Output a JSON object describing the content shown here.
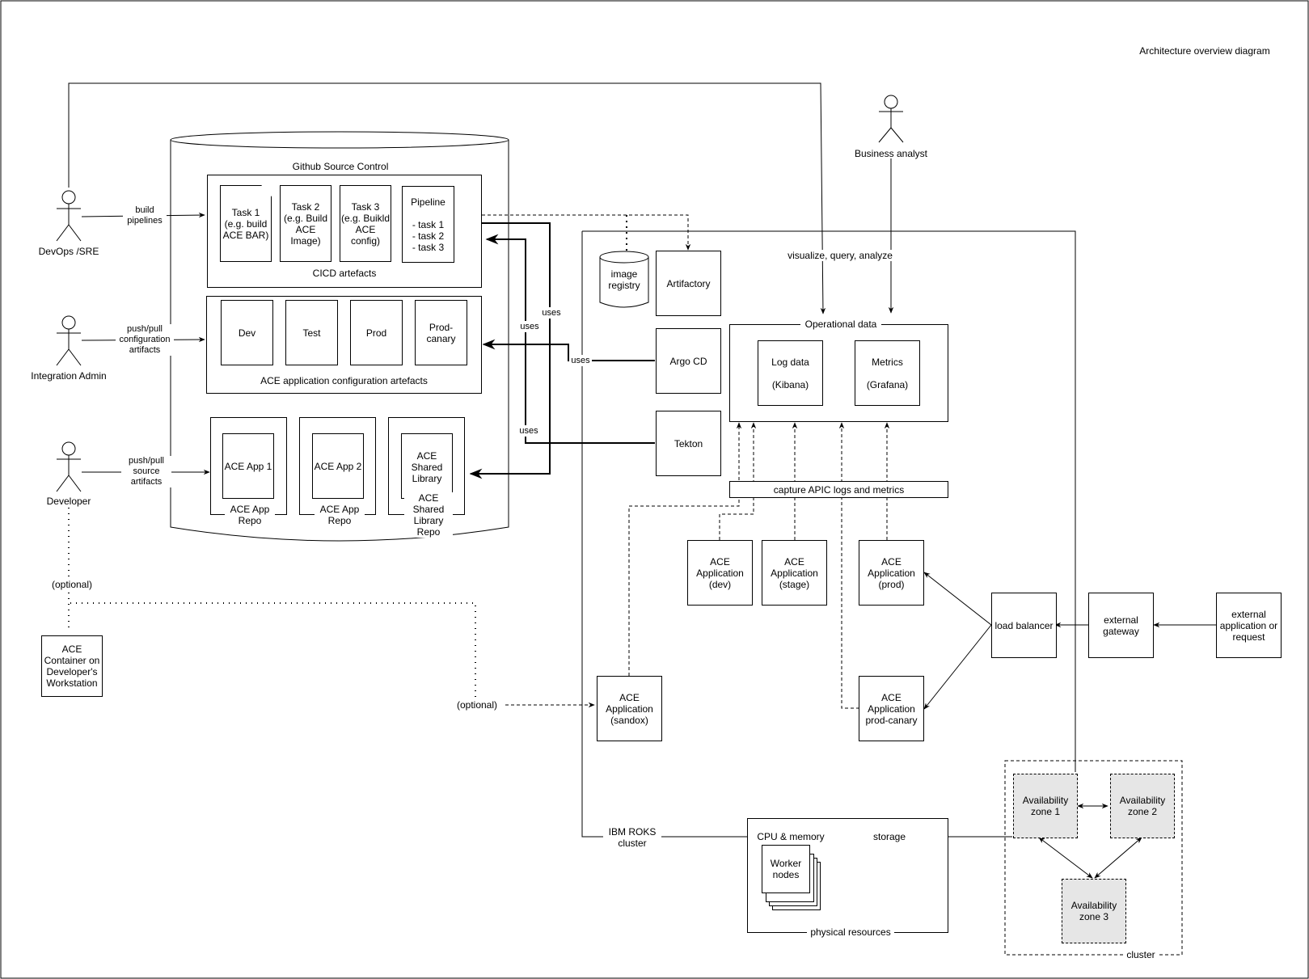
{
  "title": "Architecture overview diagram",
  "actors": {
    "devops": "DevOps /SRE",
    "integration_admin": "Integration Admin",
    "developer": "Developer",
    "business_analyst": "Business analyst"
  },
  "edge_labels": {
    "build_pipelines": "build\npipelines",
    "push_pull_config": "push/pull\nconfiguration\nartifacts",
    "push_pull_source": "push/pull\nsource\nartifacts",
    "uses": "uses",
    "optional": "(optional)",
    "visualize": "visualize, query, analyze"
  },
  "github": {
    "title": "Github Source Control",
    "cicd": {
      "caption": "CICD artefacts",
      "docs": [
        "Task 1\n(e.g. build\nACE BAR)",
        "Task 2\n(e.g. Build\nACE\nImage)",
        "Task 3\n(e.g. Buikld\nACE\nconfig)",
        "Pipeline\n\n- task 1\n- task 2\n- task 3"
      ]
    },
    "config": {
      "caption": "ACE application configuration artefacts",
      "docs": [
        "Dev",
        "Test",
        "Prod",
        "Prod-\ncanary"
      ]
    },
    "repos": [
      {
        "doc": "ACE App 1",
        "caption": "ACE App\nRepo"
      },
      {
        "doc": "ACE App 2",
        "caption": "ACE App\nRepo"
      },
      {
        "doc": "ACE\nShared\nLibrary",
        "caption": "ACE\nShared\nLibrary\nRepo"
      }
    ]
  },
  "ace_container": "ACE\nContainer on\nDeveloper's\nWorkstation",
  "cluster_tools": {
    "image_registry": "image\nregistry",
    "artifactory": "Artifactory",
    "argo_cd": "Argo CD",
    "tekton": "Tekton"
  },
  "operational_data": {
    "title": "Operational data",
    "log_data": "Log data\n\n(Kibana)",
    "metrics": "Metrics\n\n(Grafana)"
  },
  "capture_bar": "capture APIC logs and metrics",
  "ace_apps": {
    "dev": "ACE\nApplication\n(dev)",
    "stage": "ACE\nApplication\n(stage)",
    "prod": "ACE\nApplication\n(prod)",
    "sandbox": "ACE\nApplication\n(sandox)",
    "prod_canary": "ACE\nApplication\nprod-canary"
  },
  "network": {
    "load_balancer": "load balancer",
    "external_gateway": "external\ngateway",
    "external_app": "external\napplication or\nrequest"
  },
  "roks_cluster": "IBM ROKS\ncluster",
  "physical": {
    "caption": "physical resources",
    "cpu_memory": "CPU & memory",
    "worker_nodes": "Worker\nnodes",
    "storage": "storage"
  },
  "availability": {
    "caption": "cluster",
    "zones": [
      "Availability\nzone 1",
      "Availability\nzone 2",
      "Availability\nzone 3"
    ]
  }
}
